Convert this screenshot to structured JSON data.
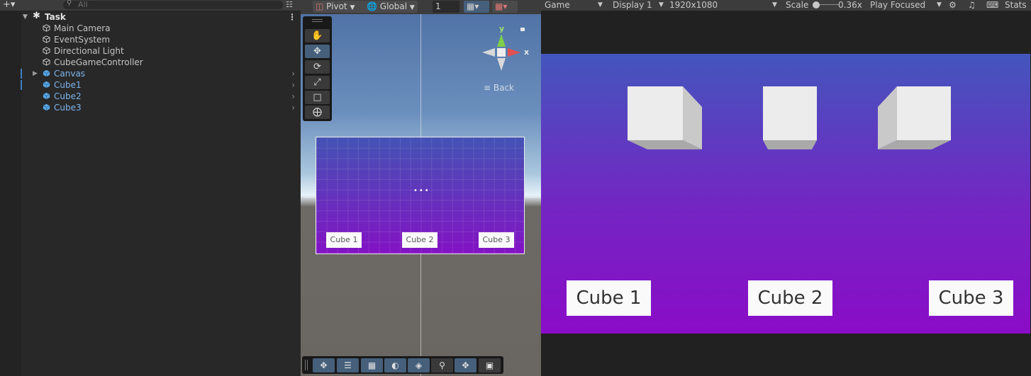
{
  "hierarchy": {
    "add_label": "+▾",
    "search_placeholder": "All",
    "scene_name": "Task",
    "items": [
      {
        "label": "Main Camera"
      },
      {
        "label": "EventSystem"
      },
      {
        "label": "Directional Light"
      },
      {
        "label": "CubeGameController"
      },
      {
        "label": "Canvas"
      },
      {
        "label": "Cube1"
      },
      {
        "label": "Cube2"
      },
      {
        "label": "Cube3"
      }
    ]
  },
  "scene": {
    "pivot_label": "Pivot",
    "global_label": "Global",
    "snap_value": "1",
    "back_label": "≡ Back",
    "gizmo_y": "y",
    "gizmo_x": "x",
    "canvas_buttons": [
      "Cube 1",
      "Cube 2",
      "Cube 3"
    ]
  },
  "game": {
    "tab_label": "Game",
    "display_label": "Display 1",
    "resolution_label": "1920x1080",
    "scale_label": "Scale",
    "scale_value": "0.36x",
    "play_mode_label": "Play Focused",
    "stats_label": "Stats",
    "buttons": [
      "Cube 1",
      "Cube 2",
      "Cube 3"
    ]
  },
  "colors": {
    "selected_text": "#7cb5ec",
    "panel_bg": "#282828",
    "toolbar_bg": "#3c3c3c",
    "game_gradient_top": "#4356bd",
    "game_gradient_bottom": "#8a0cc7"
  }
}
